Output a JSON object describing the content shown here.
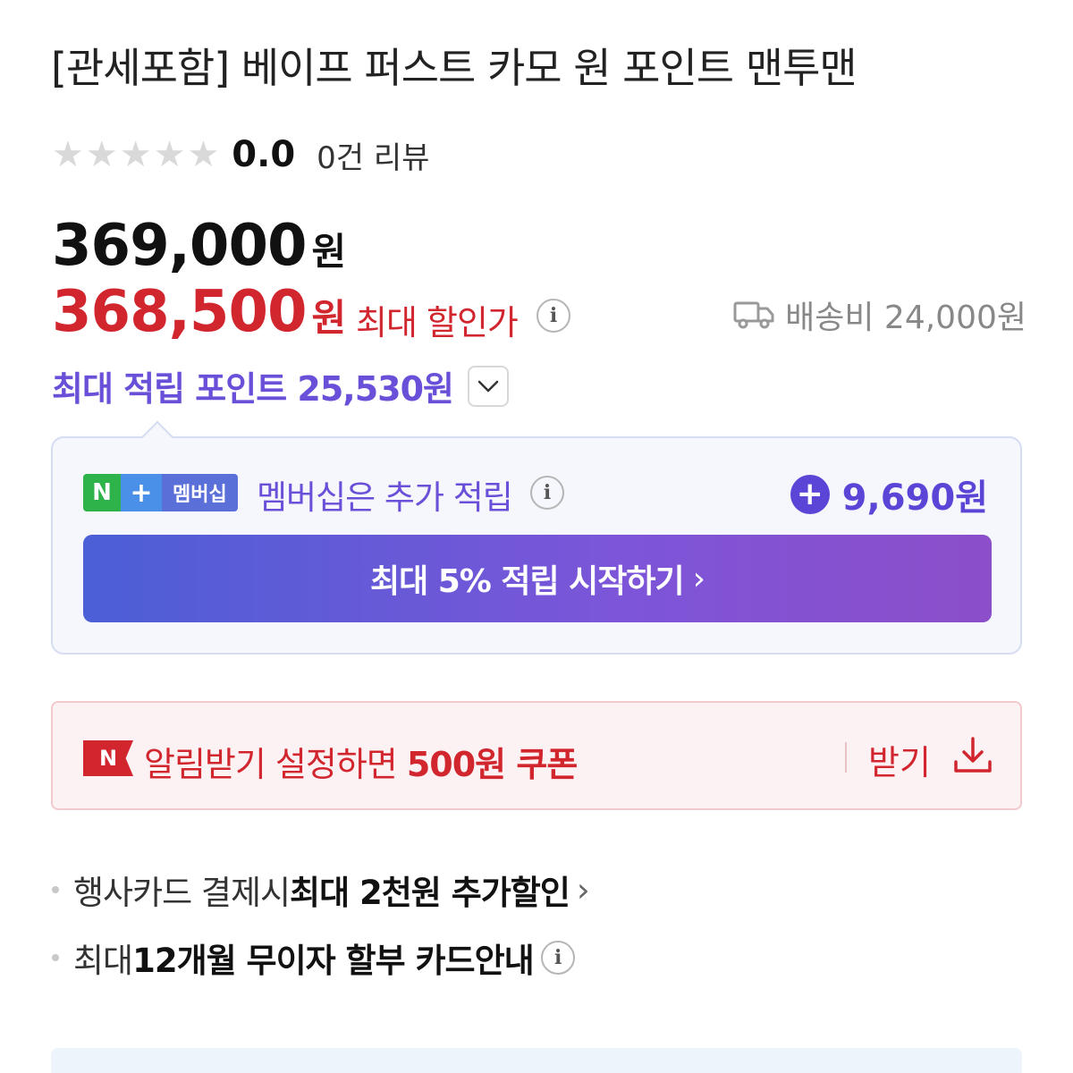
{
  "product": {
    "title": "[관세포함] 베이프 퍼스트 카모 원 포인트 맨투맨"
  },
  "rating": {
    "stars": 0,
    "max_stars": 5,
    "score": "0.0",
    "review_count": "0건 리뷰"
  },
  "price": {
    "original": "369,000",
    "original_unit": "원",
    "sale": "368,500",
    "sale_unit": "원",
    "sale_label": "최대 할인가",
    "shipping": "배송비 24,000원"
  },
  "points": {
    "label": "최대 적립 포인트 25,530원"
  },
  "membership": {
    "logo_n": "N",
    "logo_plus": "+",
    "logo_text": "멤버십",
    "description": "멤버십은 추가 적립",
    "amount": "9,690원",
    "cta_label": "최대 5% 적립 시작하기",
    "cta_arrow": "›"
  },
  "coupon": {
    "badge": "N",
    "text_plain": "알림받기 설정하면 ",
    "text_bold": "500원 쿠폰",
    "get_label": "받기"
  },
  "benefits": {
    "card_discount_plain": "행사카드 결제시 ",
    "card_discount_bold": "최대 2천원 추가할인",
    "installment_plain": "최대 ",
    "installment_bold": "12개월 무이자 할부 카드안내"
  },
  "icons": {
    "info": "i",
    "chevron": "›",
    "star": "★"
  },
  "colors": {
    "sale_red": "#d2262f",
    "point_purple": "#6a4fd8",
    "membership_green": "#2db34a"
  }
}
